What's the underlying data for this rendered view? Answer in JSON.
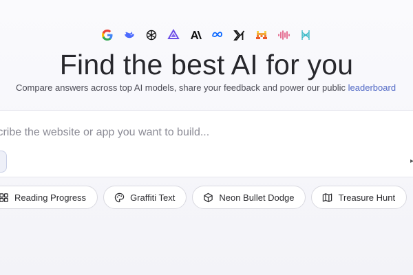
{
  "header": {
    "model_logos": [
      {
        "icon": "google-icon"
      },
      {
        "icon": "deepseek-whale-icon"
      },
      {
        "icon": "openai-icon"
      },
      {
        "icon": "purple-triangle-icon"
      },
      {
        "icon": "anthropic-icon"
      },
      {
        "icon": "meta-icon"
      },
      {
        "icon": "xai-icon"
      },
      {
        "icon": "mistral-icon"
      },
      {
        "icon": "soundwave-icon"
      },
      {
        "icon": "cyan-network-icon"
      }
    ],
    "title": "Find the best AI for you",
    "subtitle_text": "Compare answers across top AI models, share your feedback and power our public",
    "subtitle_link": "leaderboard"
  },
  "prompt": {
    "placeholder": "Describe the website or app you want to build..."
  },
  "suggestions": [
    {
      "label": "Reading Progress",
      "icon": "grid-layout-icon"
    },
    {
      "label": "Graffiti Text",
      "icon": "palette-icon"
    },
    {
      "label": "Neon Bullet Dodge",
      "icon": "cube-icon"
    },
    {
      "label": "Treasure Hunt",
      "icon": "map-icon"
    }
  ],
  "colors": {
    "link": "#4f67c5",
    "title": "#27272c",
    "background": "#f7f7fb"
  }
}
